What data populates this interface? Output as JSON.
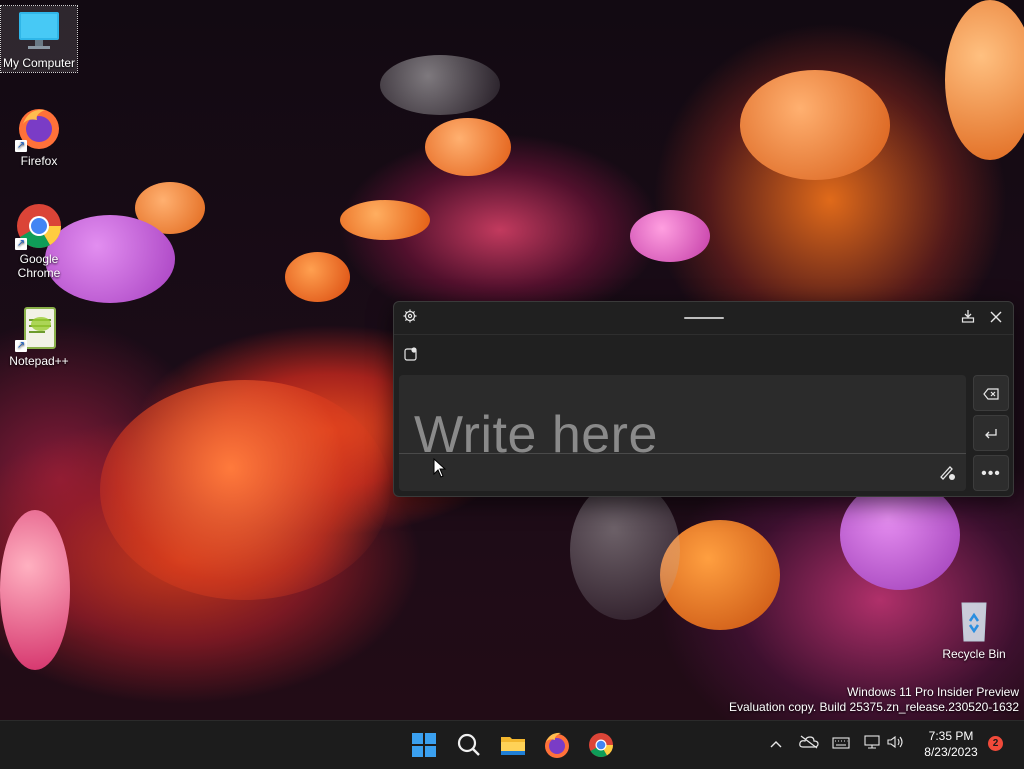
{
  "desktop": {
    "icons": [
      {
        "label": "My Computer",
        "icon": "computer-icon"
      },
      {
        "label": "Firefox",
        "icon": "firefox-icon"
      },
      {
        "label": "Google Chrome",
        "icon": "chrome-icon"
      },
      {
        "label": "Notepad++",
        "icon": "notepadpp-icon"
      },
      {
        "label": "Recycle Bin",
        "icon": "recycle-bin-icon"
      }
    ]
  },
  "handwriting_panel": {
    "placeholder": "Write here",
    "buttons": {
      "settings": "gear-icon",
      "dock": "dock-icon",
      "close": "close-icon",
      "emoji": "emoji-icon",
      "backspace": "backspace-icon",
      "enter": "enter-icon",
      "pen": "pen-icon",
      "more": "more-icon"
    }
  },
  "watermark": {
    "line1": "Windows 11 Pro Insider Preview",
    "line2": "Evaluation copy. Build 25375.zn_release.230520-1632"
  },
  "taskbar": {
    "apps": [
      "start-icon",
      "search-icon",
      "file-explorer-icon",
      "firefox-icon",
      "chrome-icon"
    ],
    "tray": [
      "chevron-up-icon",
      "onedrive-icon",
      "keyboard-icon",
      "network-icon",
      "volume-icon"
    ],
    "clock": {
      "time": "7:35 PM",
      "date": "8/23/2023"
    },
    "notifications": "2"
  },
  "colors": {
    "panel_bg": "#202020",
    "taskbar_bg": "#1c1c1c",
    "badge": "#f04a3a"
  }
}
